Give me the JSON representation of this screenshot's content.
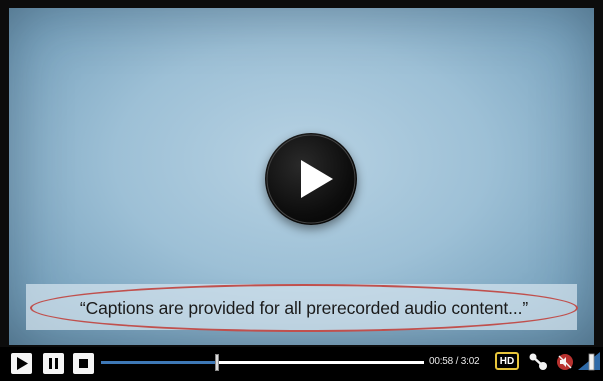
{
  "video": {
    "caption": "“Captions are provided for all prerecorded audio content...”"
  },
  "controls": {
    "time": "00:58 / 3:02",
    "quality_badge": "HD",
    "progress": 0.36
  },
  "icons": {
    "big_play": "play-circle-icon",
    "play": "play-icon",
    "pause": "pause-icon",
    "stop": "stop-icon",
    "share": "share-icon",
    "mute": "mute-icon",
    "volume": "volume-level-icon"
  },
  "colors": {
    "caption_highlight": "#c0504d",
    "hd_border": "#e7c53b",
    "progress": "#3e78b6"
  }
}
